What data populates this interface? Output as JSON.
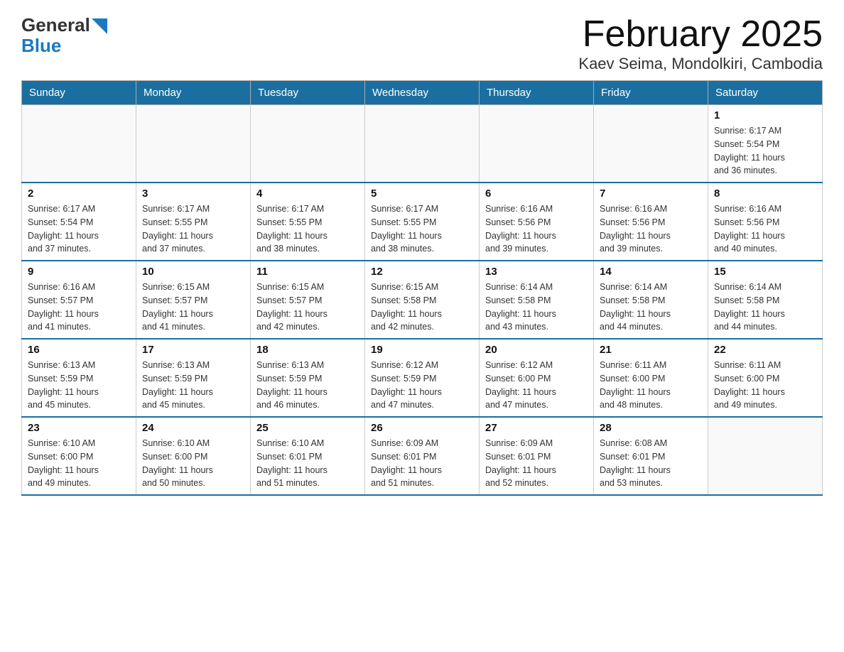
{
  "logo": {
    "general": "General",
    "blue": "Blue",
    "alt": "GeneralBlue logo"
  },
  "title": "February 2025",
  "subtitle": "Kaev Seima, Mondolkiri, Cambodia",
  "days_of_week": [
    "Sunday",
    "Monday",
    "Tuesday",
    "Wednesday",
    "Thursday",
    "Friday",
    "Saturday"
  ],
  "weeks": [
    [
      {
        "day": "",
        "info": ""
      },
      {
        "day": "",
        "info": ""
      },
      {
        "day": "",
        "info": ""
      },
      {
        "day": "",
        "info": ""
      },
      {
        "day": "",
        "info": ""
      },
      {
        "day": "",
        "info": ""
      },
      {
        "day": "1",
        "info": "Sunrise: 6:17 AM\nSunset: 5:54 PM\nDaylight: 11 hours\nand 36 minutes."
      }
    ],
    [
      {
        "day": "2",
        "info": "Sunrise: 6:17 AM\nSunset: 5:54 PM\nDaylight: 11 hours\nand 37 minutes."
      },
      {
        "day": "3",
        "info": "Sunrise: 6:17 AM\nSunset: 5:55 PM\nDaylight: 11 hours\nand 37 minutes."
      },
      {
        "day": "4",
        "info": "Sunrise: 6:17 AM\nSunset: 5:55 PM\nDaylight: 11 hours\nand 38 minutes."
      },
      {
        "day": "5",
        "info": "Sunrise: 6:17 AM\nSunset: 5:55 PM\nDaylight: 11 hours\nand 38 minutes."
      },
      {
        "day": "6",
        "info": "Sunrise: 6:16 AM\nSunset: 5:56 PM\nDaylight: 11 hours\nand 39 minutes."
      },
      {
        "day": "7",
        "info": "Sunrise: 6:16 AM\nSunset: 5:56 PM\nDaylight: 11 hours\nand 39 minutes."
      },
      {
        "day": "8",
        "info": "Sunrise: 6:16 AM\nSunset: 5:56 PM\nDaylight: 11 hours\nand 40 minutes."
      }
    ],
    [
      {
        "day": "9",
        "info": "Sunrise: 6:16 AM\nSunset: 5:57 PM\nDaylight: 11 hours\nand 41 minutes."
      },
      {
        "day": "10",
        "info": "Sunrise: 6:15 AM\nSunset: 5:57 PM\nDaylight: 11 hours\nand 41 minutes."
      },
      {
        "day": "11",
        "info": "Sunrise: 6:15 AM\nSunset: 5:57 PM\nDaylight: 11 hours\nand 42 minutes."
      },
      {
        "day": "12",
        "info": "Sunrise: 6:15 AM\nSunset: 5:58 PM\nDaylight: 11 hours\nand 42 minutes."
      },
      {
        "day": "13",
        "info": "Sunrise: 6:14 AM\nSunset: 5:58 PM\nDaylight: 11 hours\nand 43 minutes."
      },
      {
        "day": "14",
        "info": "Sunrise: 6:14 AM\nSunset: 5:58 PM\nDaylight: 11 hours\nand 44 minutes."
      },
      {
        "day": "15",
        "info": "Sunrise: 6:14 AM\nSunset: 5:58 PM\nDaylight: 11 hours\nand 44 minutes."
      }
    ],
    [
      {
        "day": "16",
        "info": "Sunrise: 6:13 AM\nSunset: 5:59 PM\nDaylight: 11 hours\nand 45 minutes."
      },
      {
        "day": "17",
        "info": "Sunrise: 6:13 AM\nSunset: 5:59 PM\nDaylight: 11 hours\nand 45 minutes."
      },
      {
        "day": "18",
        "info": "Sunrise: 6:13 AM\nSunset: 5:59 PM\nDaylight: 11 hours\nand 46 minutes."
      },
      {
        "day": "19",
        "info": "Sunrise: 6:12 AM\nSunset: 5:59 PM\nDaylight: 11 hours\nand 47 minutes."
      },
      {
        "day": "20",
        "info": "Sunrise: 6:12 AM\nSunset: 6:00 PM\nDaylight: 11 hours\nand 47 minutes."
      },
      {
        "day": "21",
        "info": "Sunrise: 6:11 AM\nSunset: 6:00 PM\nDaylight: 11 hours\nand 48 minutes."
      },
      {
        "day": "22",
        "info": "Sunrise: 6:11 AM\nSunset: 6:00 PM\nDaylight: 11 hours\nand 49 minutes."
      }
    ],
    [
      {
        "day": "23",
        "info": "Sunrise: 6:10 AM\nSunset: 6:00 PM\nDaylight: 11 hours\nand 49 minutes."
      },
      {
        "day": "24",
        "info": "Sunrise: 6:10 AM\nSunset: 6:00 PM\nDaylight: 11 hours\nand 50 minutes."
      },
      {
        "day": "25",
        "info": "Sunrise: 6:10 AM\nSunset: 6:01 PM\nDaylight: 11 hours\nand 51 minutes."
      },
      {
        "day": "26",
        "info": "Sunrise: 6:09 AM\nSunset: 6:01 PM\nDaylight: 11 hours\nand 51 minutes."
      },
      {
        "day": "27",
        "info": "Sunrise: 6:09 AM\nSunset: 6:01 PM\nDaylight: 11 hours\nand 52 minutes."
      },
      {
        "day": "28",
        "info": "Sunrise: 6:08 AM\nSunset: 6:01 PM\nDaylight: 11 hours\nand 53 minutes."
      },
      {
        "day": "",
        "info": ""
      }
    ]
  ]
}
